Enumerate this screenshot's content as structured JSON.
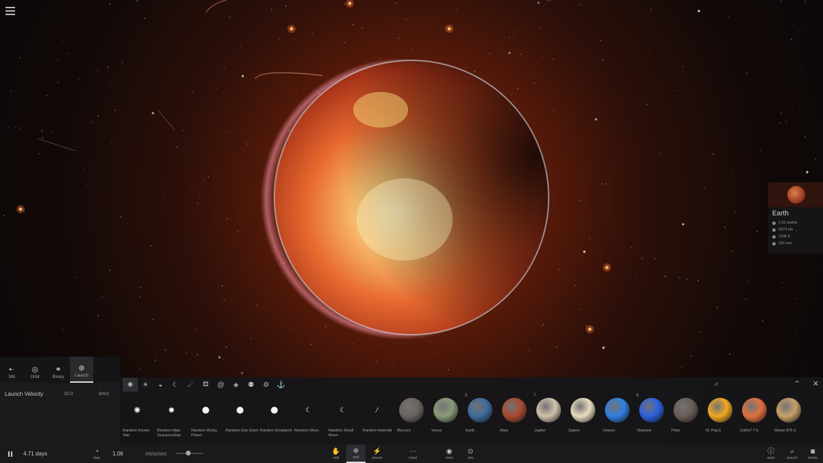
{
  "scene": {
    "colors": {
      "background": "#0b0808",
      "glow": "#ff5a14"
    }
  },
  "menu": {
    "icon": "hamburger-icon"
  },
  "selected_object": {
    "name": "Earth",
    "stats": [
      {
        "icon": "mass-icon",
        "value": "1.02 earths"
      },
      {
        "icon": "radius-icon",
        "value": "6373 km"
      },
      {
        "icon": "temperature-icon",
        "value": "1338 K"
      },
      {
        "icon": "velocity-icon",
        "value": "106 m/s"
      }
    ]
  },
  "modes": [
    {
      "label": "Still",
      "icon": "still-icon",
      "glyph": "•·"
    },
    {
      "label": "Orbit",
      "icon": "orbit-icon",
      "glyph": "◎"
    },
    {
      "label": "Binary",
      "icon": "binary-icon",
      "glyph": "⚭"
    },
    {
      "label": "Launch",
      "icon": "launch-icon",
      "glyph": "⊕"
    }
  ],
  "launch": {
    "label": "Launch Velocity",
    "value": "10.0",
    "unit": "km/s"
  },
  "categories": [
    {
      "icon": "stars-category-icon",
      "glyph": "✺"
    },
    {
      "icon": "sun-category-icon",
      "glyph": "☀"
    },
    {
      "icon": "planet-category-icon",
      "glyph": "◒"
    },
    {
      "icon": "moon-category-icon",
      "glyph": "☾"
    },
    {
      "icon": "comet-category-icon",
      "glyph": "☄"
    },
    {
      "icon": "ship-category-icon",
      "glyph": "⛾"
    },
    {
      "icon": "galaxy-category-icon",
      "glyph": "@"
    },
    {
      "icon": "asteroid-category-icon",
      "glyph": "◈"
    },
    {
      "icon": "people-category-icon",
      "glyph": "⚉"
    },
    {
      "icon": "settings-category-icon",
      "glyph": "⚙"
    },
    {
      "icon": "anchor-category-icon",
      "glyph": "⚓"
    }
  ],
  "items": [
    {
      "label": "Random Known Star",
      "kind": "star",
      "glyph": "✺"
    },
    {
      "label": "Random Main SequenceStar",
      "kind": "star",
      "glyph": "✹"
    },
    {
      "label": "Random Rocky Planet",
      "kind": "dot"
    },
    {
      "label": "Random Gas Giant",
      "kind": "dot"
    },
    {
      "label": "Random Exoplanet",
      "kind": "dot"
    },
    {
      "label": "Random Moon",
      "kind": "moon",
      "glyph": "☾"
    },
    {
      "label": "Random Small Moon",
      "kind": "moon",
      "glyph": "☾"
    },
    {
      "label": "Random Asteroid",
      "kind": "moon",
      "glyph": "⁄"
    },
    {
      "label": "Mercury",
      "kind": "planet",
      "color": "#6b6460"
    },
    {
      "label": "Venus",
      "kind": "planet",
      "color": "#8a9a78"
    },
    {
      "label": "Earth",
      "kind": "planet",
      "color": "#3e6c9c",
      "badge": "5"
    },
    {
      "label": "Mars",
      "kind": "planet",
      "color": "#a84a30"
    },
    {
      "label": "Jupiter",
      "kind": "planet",
      "color": "#cfc2aa",
      "badge": "7"
    },
    {
      "label": "Saturn",
      "kind": "planet",
      "color": "#e8dcc0"
    },
    {
      "label": "Uranus",
      "kind": "planet",
      "color": "#2f7fe0"
    },
    {
      "label": "Neptune",
      "kind": "planet",
      "color": "#2a5fe0",
      "badge": "6"
    },
    {
      "label": "Pluto",
      "kind": "planet",
      "color": "#6a5c58"
    },
    {
      "label": "51 Peg b",
      "kind": "planet",
      "color": "#f0a820"
    },
    {
      "label": "CoRoT-7 b",
      "kind": "planet",
      "color": "#e07040"
    },
    {
      "label": "Gliese 876 d",
      "kind": "planet",
      "color": "#c8a068"
    }
  ],
  "toolbar_right": {
    "search_icon": "search-icon",
    "collapse_icon": "chevron-up-icon",
    "close_icon": "close-icon"
  },
  "bottom": {
    "time": "4.71 days",
    "step_label": "step",
    "speed_value": "1.06",
    "speed_unit": "mins/sec",
    "speed_level": 0.45,
    "center_buttons": [
      {
        "label": "edit",
        "icon": "hand-icon",
        "glyph": "✋"
      },
      {
        "label": "add",
        "icon": "add-icon",
        "glyph": "⊕",
        "active": true
      },
      {
        "label": "power",
        "icon": "power-icon",
        "glyph": "⚡"
      },
      {
        "label": "chart",
        "icon": "chart-icon",
        "glyph": "⋯"
      },
      {
        "label": "view",
        "icon": "eye-icon",
        "glyph": "◉"
      },
      {
        "label": "sim",
        "icon": "sim-icon",
        "glyph": "⊙"
      }
    ],
    "right_buttons": [
      {
        "label": "stats",
        "icon": "info-icon",
        "glyph": "ⓘ"
      },
      {
        "label": "search",
        "icon": "search-icon",
        "glyph": "⌕"
      },
      {
        "label": "photo",
        "icon": "camera-icon",
        "glyph": "◙"
      }
    ]
  }
}
